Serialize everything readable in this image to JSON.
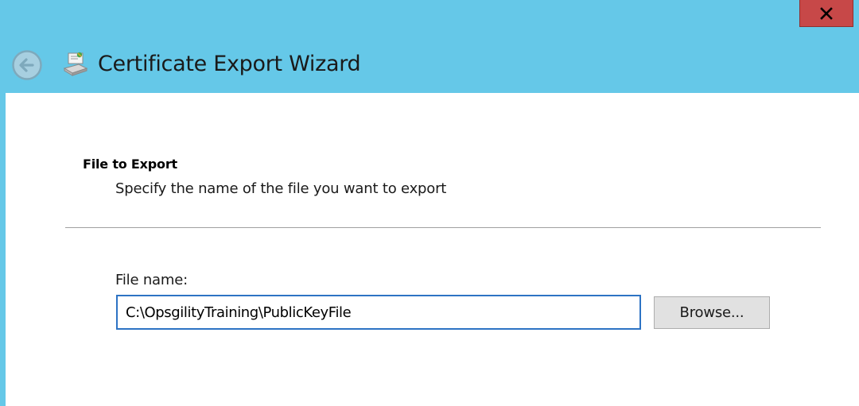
{
  "window": {
    "title": "Certificate Export Wizard",
    "close_label": "Close"
  },
  "page": {
    "section_title": "File to Export",
    "section_description": "Specify the name of the file you want to export",
    "file_name_label": "File name:",
    "file_name_value": "C:\\OpsgilityTraining\\PublicKeyFile",
    "browse_label": "Browse..."
  },
  "icons": {
    "back": "back-arrow-icon",
    "wizard": "certificate-wizard-icon",
    "close": "close-icon"
  },
  "colors": {
    "titlebar": "#65c8e8",
    "close_button": "#c74848",
    "input_focus_border": "#2d73c4",
    "content_background": "#ffffff"
  }
}
